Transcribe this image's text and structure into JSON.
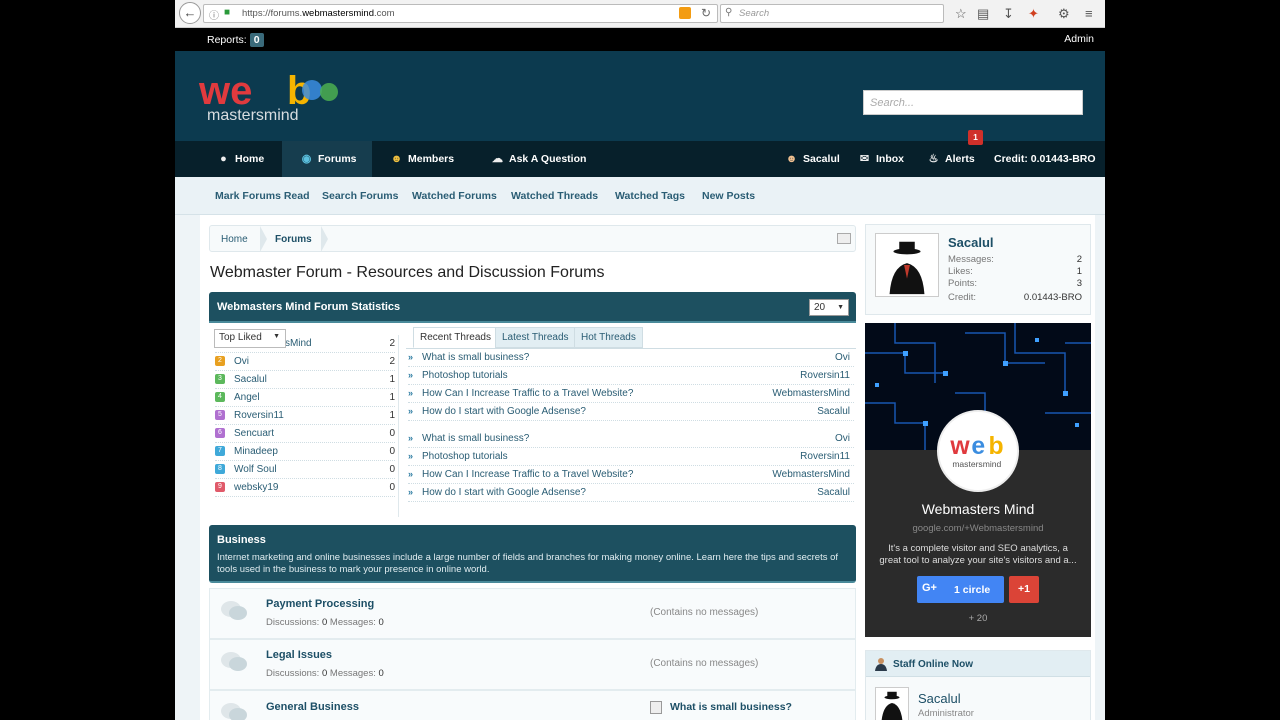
{
  "browser": {
    "url_prefix": "https://forums.",
    "url_domain": "webmastersmind",
    "url_suffix": ".com",
    "search_placeholder": "Search"
  },
  "topbar": {
    "reports_label": "Reports:",
    "reports_count": "0",
    "admin_label": "Admin"
  },
  "header": {
    "search_placeholder": "Search..."
  },
  "nav": {
    "home": "Home",
    "forums": "Forums",
    "members": "Members",
    "ask": "Ask A Question",
    "user": "Sacalul",
    "inbox": "Inbox",
    "alerts": "Alerts",
    "alerts_count": "1",
    "credit": "Credit: 0.01443-BRO"
  },
  "subnav": [
    "Mark Forums Read",
    "Search Forums",
    "Watched Forums",
    "Watched Threads",
    "Watched Tags",
    "New Posts"
  ],
  "breadcrumb": [
    "Home",
    "Forums"
  ],
  "page_title": "Webmaster Forum - Resources and Discussion Forums",
  "stats": {
    "title": "Webmasters Mind Forum Statistics",
    "count_select": "20",
    "top_liked_label": "Top Liked",
    "top_liked": [
      {
        "rank": "1",
        "name": "WebmastersMind",
        "value": "2",
        "color": "#e8a020"
      },
      {
        "rank": "2",
        "name": "Ovi",
        "value": "2",
        "color": "#e8a020"
      },
      {
        "rank": "3",
        "name": "Sacalul",
        "value": "1",
        "color": "#5cb85c"
      },
      {
        "rank": "4",
        "name": "Angel",
        "value": "1",
        "color": "#5cb85c"
      },
      {
        "rank": "5",
        "name": "Roversin11",
        "value": "1",
        "color": "#b070d0"
      },
      {
        "rank": "6",
        "name": "Sencuart",
        "value": "0",
        "color": "#b070d0"
      },
      {
        "rank": "7",
        "name": "Minadeep",
        "value": "0",
        "color": "#3fa9d9"
      },
      {
        "rank": "8",
        "name": "Wolf Soul",
        "value": "0",
        "color": "#3fa9d9"
      },
      {
        "rank": "9",
        "name": "websky19",
        "value": "0",
        "color": "#e05a6a"
      }
    ],
    "tabs": [
      "Recent Threads",
      "Latest Threads",
      "Hot Threads"
    ],
    "threads": [
      {
        "title": "What is small business?",
        "user": "Ovi"
      },
      {
        "title": "Photoshop tutorials",
        "user": "Roversin11"
      },
      {
        "title": "How Can I Increase Traffic to a Travel Website?",
        "user": "WebmastersMind"
      },
      {
        "title": "How do I start with Google Adsense?",
        "user": "Sacalul"
      },
      {
        "title": "What is small business?",
        "user": "Ovi"
      },
      {
        "title": "Photoshop tutorials",
        "user": "Roversin11"
      },
      {
        "title": "How Can I Increase Traffic to a Travel Website?",
        "user": "WebmastersMind"
      },
      {
        "title": "How do I start with Google Adsense?",
        "user": "Sacalul"
      }
    ]
  },
  "business": {
    "title": "Business",
    "description": "Internet marketing and online businesses include a large number of fields and branches for making money online. Learn here the tips and secrets of tools used in the business to mark your presence in online world.",
    "forums": [
      {
        "title": "Payment Processing",
        "discussions_label": "Discussions:",
        "discussions": "0",
        "messages_label": "Messages:",
        "messages": "0",
        "last": "(Contains no messages)"
      },
      {
        "title": "Legal Issues",
        "discussions_label": "Discussions:",
        "discussions": "0",
        "messages_label": "Messages:",
        "messages": "0",
        "last": "(Contains no messages)"
      },
      {
        "title": "General Business",
        "last_title": "What is small business?"
      }
    ]
  },
  "profile": {
    "name": "Sacalul",
    "stats": [
      {
        "label": "Messages:",
        "value": "2"
      },
      {
        "label": "Likes:",
        "value": "1"
      },
      {
        "label": "Points:",
        "value": "3"
      },
      {
        "label": "Credit:",
        "value": "0.01443-BRO"
      }
    ]
  },
  "gplus": {
    "name": "Webmasters Mind",
    "url": "google.com/+Webmastersmind",
    "description": "It's a complete visitor and SEO analytics, a great tool to analyze your site's visitors and a...",
    "circle_label": "1 circle",
    "plus_label": "+1",
    "count": "+ 20"
  },
  "staff": {
    "title": "Staff Online Now",
    "name": "Sacalul",
    "role": "Administrator"
  },
  "colors": {
    "header_bg": "#0c3a4f",
    "nav_bg": "#07202b",
    "section_head": "#1d5060",
    "link": "#2a5d74"
  }
}
